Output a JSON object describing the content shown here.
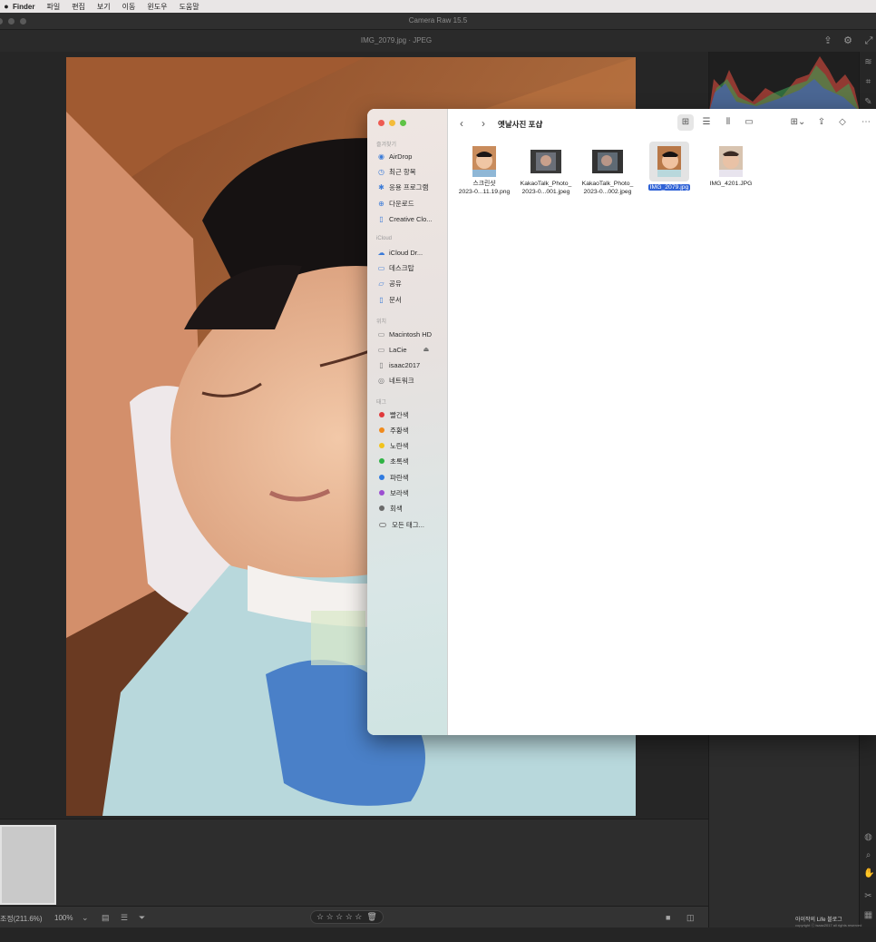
{
  "menubar": {
    "app": "Finder",
    "items": [
      "파일",
      "편집",
      "보기",
      "이동",
      "윈도우",
      "도움말"
    ]
  },
  "camera_raw": {
    "window_title": "Camera Raw 15.5",
    "file_label": "IMG_2079.jpg  ·  JPEG",
    "zoom_label": "조정(211.6%)",
    "zoom_value": "100%",
    "rating_stars": "☆ ☆ ☆ ☆ ☆",
    "icons": [
      "export-icon",
      "gear-icon",
      "fullscreen-icon",
      "crop-icon",
      "heal-icon",
      "mask-icon",
      "zoom-icon",
      "hand-icon",
      "grid-icon"
    ]
  },
  "finder": {
    "title": "옛날사진 포샵",
    "sidebar": {
      "favorites_label": "즐겨찾기",
      "favorites": [
        "AirDrop",
        "최근 항목",
        "응용 프로그램",
        "다운로드",
        "Creative Clo..."
      ],
      "icloud_label": "iCloud",
      "icloud": [
        "iCloud Dr...",
        "데스크탑",
        "공유",
        "문서"
      ],
      "locations_label": "위치",
      "locations": [
        "Macintosh HD",
        "LaCie",
        "isaac2017",
        "네트워크"
      ],
      "tags_label": "태그",
      "tags": [
        {
          "name": "빨간색",
          "color": "#e0393b"
        },
        {
          "name": "주황색",
          "color": "#f08a1c"
        },
        {
          "name": "노란색",
          "color": "#f2c31b"
        },
        {
          "name": "초록색",
          "color": "#2fb344"
        },
        {
          "name": "파란색",
          "color": "#2f7be0"
        },
        {
          "name": "보라색",
          "color": "#9c4fd1"
        },
        {
          "name": "회색",
          "color": "#8a8a8a"
        },
        {
          "name": "모든 태그...",
          "color": ""
        }
      ]
    },
    "files": [
      {
        "line1": "스크린샷",
        "line2": "2023-0...11.19.png",
        "selected": false
      },
      {
        "line1": "KakaoTalk_Photo_",
        "line2": "2023-0...001.jpeg",
        "selected": false
      },
      {
        "line1": "KakaoTalk_Photo_",
        "line2": "2023-0...002.jpeg",
        "selected": false
      },
      {
        "line1": "IMG_2079.jpg",
        "line2": "",
        "selected": true
      },
      {
        "line1": "IMG_4201.JPG",
        "line2": "",
        "selected": false
      }
    ]
  },
  "watermark": {
    "text": "아이작의 Life 블로그",
    "sub": "copyright ⓒ isaac2017 all rights reserved"
  },
  "colors": {
    "accent": "#2f62d6",
    "app_bg": "#262626",
    "panel_bg": "#2d2d2d"
  }
}
